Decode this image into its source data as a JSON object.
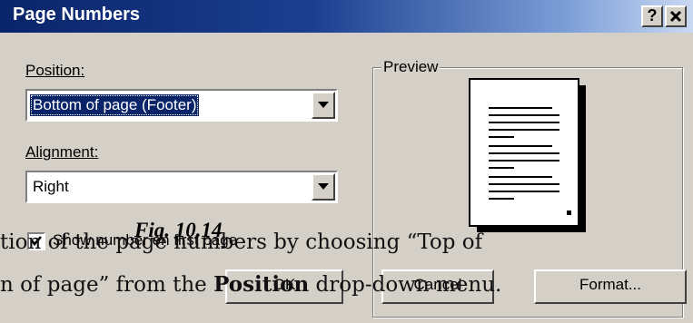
{
  "dialog": {
    "title": "Page Numbers",
    "help_button": "?",
    "close_button": "✕",
    "position_label": "Position:",
    "position_value": "Bottom of page (Footer)",
    "alignment_label": "Alignment:",
    "alignment_value": "Right",
    "show_number_label": "Show number on first page",
    "show_number_checked": true,
    "preview_label": "Preview",
    "ok_button": "OK",
    "cancel_button": "Cancel",
    "format_button": "Format..."
  },
  "caption": "Fig. 10.14",
  "body_lines": [
    "tion of the page numbers by choosing “Top of",
    "n of page” from the",
    "Position",
    "drop-down menu."
  ],
  "colors": {
    "title_bar": "#0a246a",
    "dialog_face": "#d4d0c8",
    "selection": "#0a246a"
  }
}
